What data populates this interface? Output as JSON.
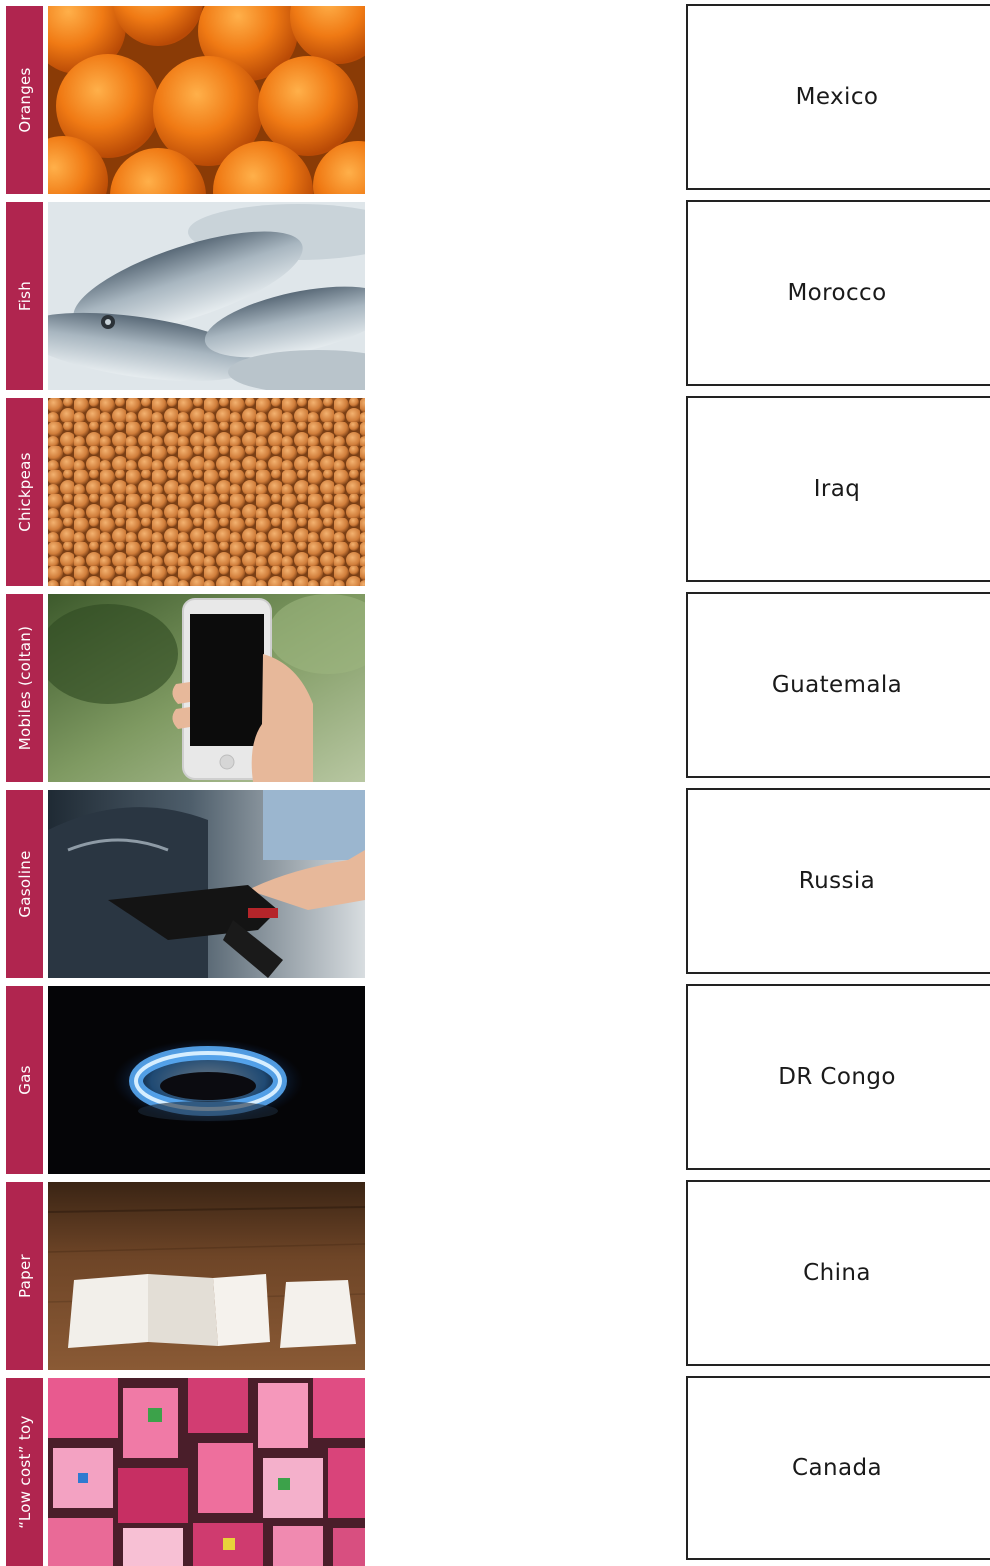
{
  "products": [
    {
      "label": "Oranges"
    },
    {
      "label": "Fish"
    },
    {
      "label": "Chickpeas"
    },
    {
      "label": "Mobiles (coltan)"
    },
    {
      "label": "Gasoline"
    },
    {
      "label": "Gas"
    },
    {
      "label": "Paper"
    },
    {
      "label": "“Low cost” toy"
    }
  ],
  "countries": [
    {
      "name": "Mexico"
    },
    {
      "name": "Morocco"
    },
    {
      "name": "Iraq"
    },
    {
      "name": "Guatemala"
    },
    {
      "name": "Russia"
    },
    {
      "name": "DR Congo"
    },
    {
      "name": "China"
    },
    {
      "name": "Canada"
    }
  ],
  "colors": {
    "label_strip": "#b0254f",
    "box_border": "#222222"
  }
}
